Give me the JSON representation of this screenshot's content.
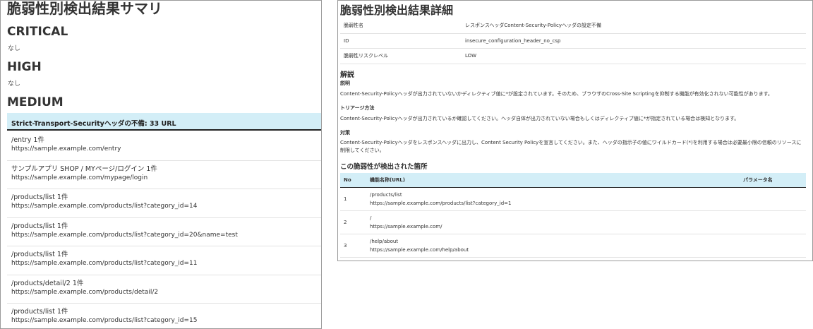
{
  "summary": {
    "title": "脆弱性別検出結果サマリ",
    "critical": {
      "label": "CRITICAL",
      "value": "なし"
    },
    "high": {
      "label": "HIGH",
      "value": "なし"
    },
    "medium": {
      "label": "MEDIUM",
      "item_header": "Strict-Transport-Securityヘッダの不備: 33 URL",
      "urls": [
        {
          "name": "/entry 1件",
          "url": "https://sample.example.com/entry"
        },
        {
          "name": "サンプルアプリ SHOP / MYページ/ログイン 1件",
          "url": "https://sample.example.com/mypage/login"
        },
        {
          "name": "/products/list 1件",
          "url": "https://sample.example.com/products/list?category_id=14"
        },
        {
          "name": "/products/list 1件",
          "url": "https://sample.example.com/products/list?category_id=20&name=test"
        },
        {
          "name": "/products/list 1件",
          "url": "https://sample.example.com/products/list?category_id=11"
        },
        {
          "name": "/products/detail/2 1件",
          "url": "https://sample.example.com/products/detail/2"
        },
        {
          "name": "/products/list 1件",
          "url": "https://sample.example.com/products/list?category_id=15"
        }
      ]
    }
  },
  "detail": {
    "title": "脆弱性別検出結果詳細",
    "info": [
      {
        "key": "脆弱性名",
        "value": "レスポンスヘッダContent-Security-Policyヘッダの設定不備"
      },
      {
        "key": "ID",
        "value": "insecure_configuration_header_no_csp"
      },
      {
        "key": "脆弱性リスクレベル",
        "value": "LOW"
      }
    ],
    "explanation_title": "解説",
    "description_title": "説明",
    "description": "Content-Security-Policyヘッダが出力されていないかディレクティブ値に*が設定されています。そのため、ブラウザのCross-Site Scriptingを抑制する機能が有効化されない可能性があります。",
    "triage_title": "トリアージ方法",
    "triage": "Content-Security-Policyヘッダが出力されているか確認してください。ヘッダ自体が出力されていない場合もしくはディレクティブ値に*が指定されている場合は検知となります。",
    "countermeasure_title": "対策",
    "countermeasure": "Content-Security-Policyヘッダをレスポンスヘッダに出力し、Content Security Policyを宣言してください。また、ヘッダの指示子の値にワイルドカード(*)を利用する場合は必要最小限の信頼のリソースに制限してください。",
    "locations_title": "この脆弱性が検出された箇所",
    "locations_headers": {
      "no": "No",
      "function": "機能名称(URL)",
      "param": "パラメータ名"
    },
    "locations": [
      {
        "no": "1",
        "name": "/products/list",
        "url": "https://sample.example.com/products/list?category_id=1",
        "param": ""
      },
      {
        "no": "2",
        "name": "/",
        "url": "https://sample.example.com/",
        "param": ""
      },
      {
        "no": "3",
        "name": "/help/about",
        "url": "https://sample.example.com/help/about",
        "param": ""
      }
    ]
  }
}
